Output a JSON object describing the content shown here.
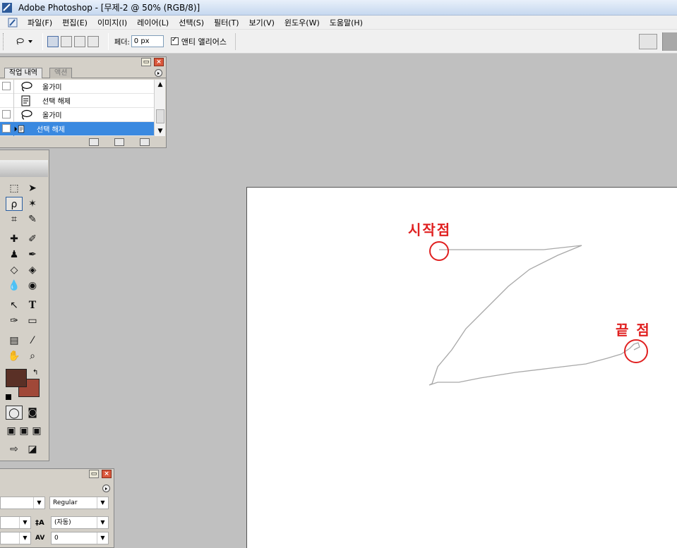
{
  "window": {
    "title": "Adobe Photoshop - [무제-2 @ 50% (RGB/8)]"
  },
  "menu": [
    "파일(F)",
    "편집(E)",
    "이미지(I)",
    "레이어(L)",
    "선택(S)",
    "필터(T)",
    "보기(V)",
    "윈도우(W)",
    "도움말(H)"
  ],
  "options": {
    "feather_label": "페더:",
    "feather_value": "0 px",
    "antialias_label": "앤티 앨리어스"
  },
  "history": {
    "tabs": [
      "작업 내역",
      "액션"
    ],
    "rows": [
      {
        "label": "올가미",
        "icon": "lasso-icon",
        "selected": false
      },
      {
        "label": "선택 해제",
        "icon": "document-icon",
        "selected": false
      },
      {
        "label": "올가미",
        "icon": "lasso-icon",
        "selected": false
      },
      {
        "label": "선택 해제",
        "icon": "document-icon",
        "selected": true
      }
    ]
  },
  "colors": {
    "foreground": "#5a3026",
    "background": "#a04838",
    "selection": "#3a89e0",
    "annotation": "#e02020"
  },
  "character": {
    "style": "Regular",
    "leading": "(자동)",
    "tracking": "0"
  },
  "annotations": {
    "start": "시작점",
    "end": "끝 점"
  }
}
